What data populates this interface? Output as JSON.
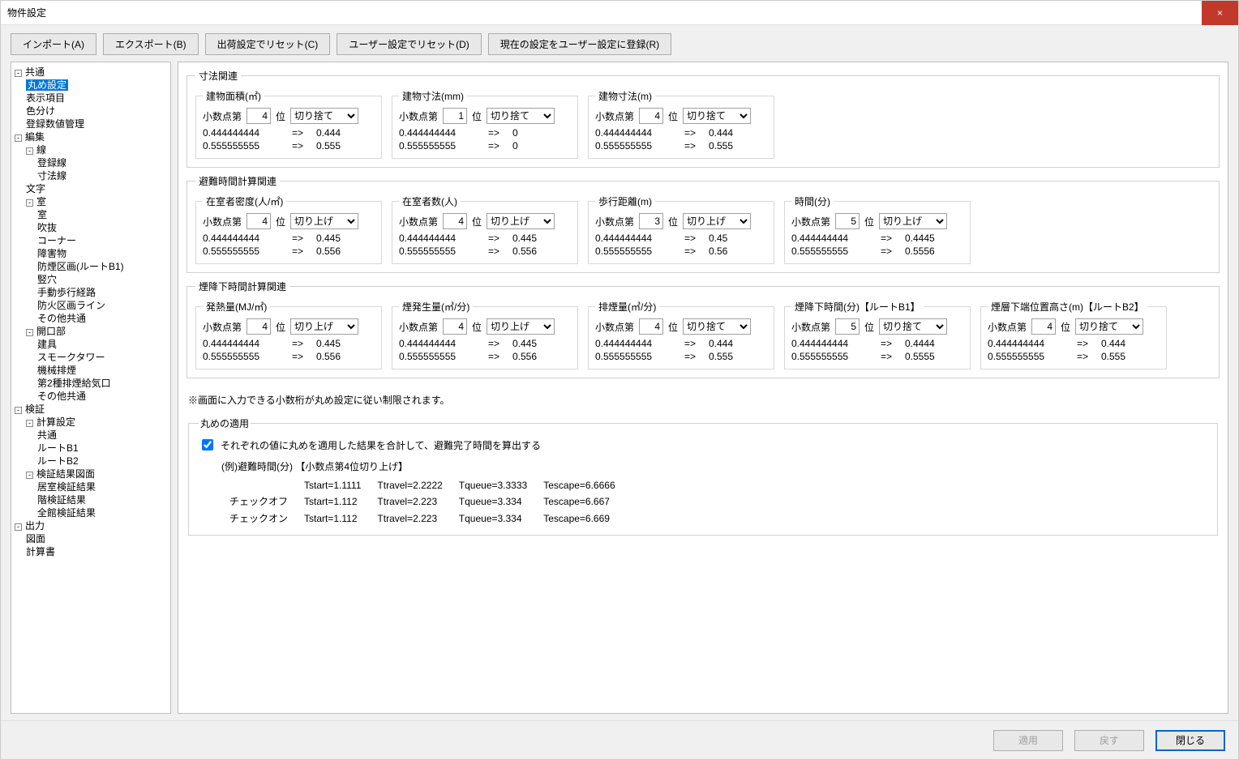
{
  "window": {
    "title": "物件設定",
    "close": "×"
  },
  "toolbar": {
    "import": "インポート(A)",
    "export": "エクスポート(B)",
    "reset_factory": "出荷設定でリセット(C)",
    "reset_user": "ユーザー設定でリセット(D)",
    "register_user": "現在の設定をユーザー設定に登録(R)"
  },
  "tree": {
    "t0": "共通",
    "t0_0": "丸め設定",
    "t0_1": "表示項目",
    "t0_2": "色分け",
    "t0_3": "登録数値管理",
    "t1": "編集",
    "t1_0": "線",
    "t1_0_0": "登録線",
    "t1_0_1": "寸法線",
    "t1_1": "文字",
    "t1_2": "室",
    "t1_2_0": "室",
    "t1_2_1": "吹抜",
    "t1_2_2": "コーナー",
    "t1_2_3": "障害物",
    "t1_2_4": "防煙区画(ルートB1)",
    "t1_2_5": "竪穴",
    "t1_2_6": "手動歩行経路",
    "t1_2_7": "防火区画ライン",
    "t1_2_8": "その他共通",
    "t1_3": "開口部",
    "t1_3_0": "建具",
    "t1_3_1": "スモークタワー",
    "t1_3_2": "機械排煙",
    "t1_3_3": "第2種排煙給気口",
    "t1_3_4": "その他共通",
    "t2": "検証",
    "t2_0": "計算設定",
    "t2_0_0": "共通",
    "t2_0_1": "ルートB1",
    "t2_0_2": "ルートB2",
    "t2_1": "検証結果図面",
    "t2_1_0": "居室検証結果",
    "t2_1_1": "階検証結果",
    "t2_1_2": "全館検証結果",
    "t3": "出力",
    "t3_0": "図面",
    "t3_1": "計算書"
  },
  "labels": {
    "decimal_prefix": "小数点第",
    "decimal_suffix": "位",
    "ex1": "0.444444444",
    "ex2": "0.555555555",
    "arrow": "=>"
  },
  "rounding": {
    "down": "切り捨て",
    "up": "切り上げ"
  },
  "groups": {
    "g1": "寸法関連",
    "g1_boxes": [
      {
        "title": "建物面積(㎡)",
        "digit": "4",
        "mode": "切り捨て",
        "r1": "0.444",
        "r2": "0.555"
      },
      {
        "title": "建物寸法(mm)",
        "digit": "1",
        "mode": "切り捨て",
        "r1": "0",
        "r2": "0"
      },
      {
        "title": "建物寸法(m)",
        "digit": "4",
        "mode": "切り捨て",
        "r1": "0.444",
        "r2": "0.555"
      }
    ],
    "g2": "避難時間計算関連",
    "g2_boxes": [
      {
        "title": "在室者密度(人/㎡)",
        "digit": "4",
        "mode": "切り上げ",
        "r1": "0.445",
        "r2": "0.556"
      },
      {
        "title": "在室者数(人)",
        "digit": "4",
        "mode": "切り上げ",
        "r1": "0.445",
        "r2": "0.556"
      },
      {
        "title": "歩行距離(m)",
        "digit": "3",
        "mode": "切り上げ",
        "r1": "0.45",
        "r2": "0.56"
      },
      {
        "title": "時間(分)",
        "digit": "5",
        "mode": "切り上げ",
        "r1": "0.4445",
        "r2": "0.5556"
      }
    ],
    "g3": "煙降下時間計算関連",
    "g3_boxes": [
      {
        "title": "発熱量(MJ/㎡)",
        "digit": "4",
        "mode": "切り上げ",
        "r1": "0.445",
        "r2": "0.556"
      },
      {
        "title": "煙発生量(㎥/分)",
        "digit": "4",
        "mode": "切り上げ",
        "r1": "0.445",
        "r2": "0.556"
      },
      {
        "title": "排煙量(㎥/分)",
        "digit": "4",
        "mode": "切り捨て",
        "r1": "0.444",
        "r2": "0.555"
      },
      {
        "title": "煙降下時間(分)【ルートB1】",
        "digit": "5",
        "mode": "切り捨て",
        "r1": "0.4444",
        "r2": "0.5555"
      },
      {
        "title": "煙層下端位置高さ(m)【ルートB2】",
        "digit": "4",
        "mode": "切り捨て",
        "r1": "0.444",
        "r2": "0.555"
      }
    ]
  },
  "note": "※画面に入力できる小数桁が丸め設定に従い制限されます。",
  "apply": {
    "legend": "丸めの適用",
    "checkbox": "それぞれの値に丸めを適用した結果を合計して、避難完了時間を算出する",
    "example_header": "(例)避難時間(分) 【小数点第4位切り上げ】",
    "rows": [
      {
        "label": "",
        "a": "Tstart=1.1111",
        "b": "Ttravel=2.2222",
        "c": "Tqueue=3.3333",
        "d": "Tescape=6.6666"
      },
      {
        "label": "チェックオフ",
        "a": "Tstart=1.112",
        "b": "Ttravel=2.223",
        "c": "Tqueue=3.334",
        "d": "Tescape=6.667"
      },
      {
        "label": "チェックオン",
        "a": "Tstart=1.112",
        "b": "Ttravel=2.223",
        "c": "Tqueue=3.334",
        "d": "Tescape=6.669"
      }
    ]
  },
  "footer": {
    "apply": "適用",
    "revert": "戻す",
    "close": "閉じる"
  }
}
